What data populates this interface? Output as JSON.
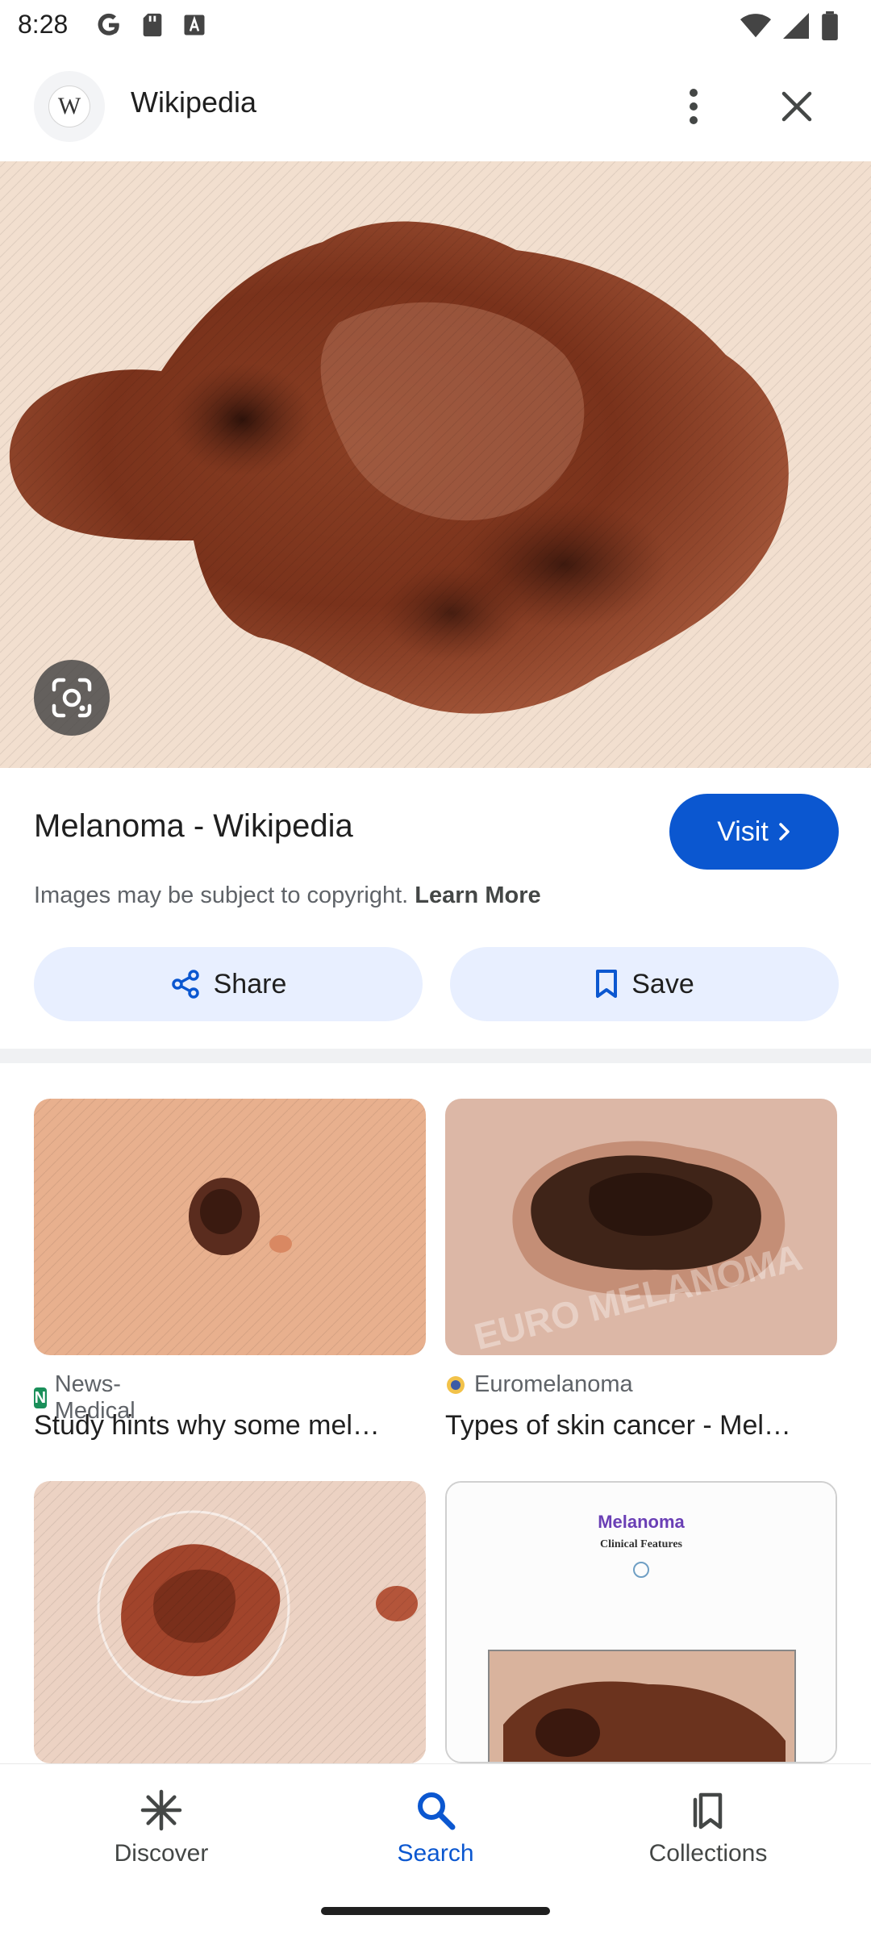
{
  "status_bar": {
    "time": "8:28"
  },
  "header": {
    "site_icon_letter": "W",
    "site_name": "Wikipedia"
  },
  "result": {
    "title": "Melanoma - Wikipedia",
    "visit_label": "Visit",
    "copyright_text": "Images may be subject to copyright.",
    "learn_more": "Learn More",
    "share_label": "Share",
    "save_label": "Save"
  },
  "related": [
    {
      "source": "News-Medical",
      "caption": "Study hints why some mel…",
      "favicon_letter": "N",
      "favicon_color": "#1a8f5a"
    },
    {
      "source": "Euromelanoma",
      "caption": "Types of skin cancer - Mel…",
      "favicon_letter": "",
      "favicon_color": "#3b5ba5"
    },
    {
      "source": "",
      "caption": "",
      "favicon_letter": "",
      "favicon_color": ""
    },
    {
      "source": "",
      "caption": "",
      "favicon_letter": "",
      "favicon_color": "",
      "image_title": "Melanoma",
      "image_subtitle": "Clinical Features"
    }
  ],
  "watermark": "EURO MELANOMA",
  "bottom_nav": {
    "discover": "Discover",
    "search": "Search",
    "collections": "Collections",
    "active": "search"
  },
  "colors": {
    "accent": "#0b57d0",
    "button_tint": "#e8efff"
  }
}
